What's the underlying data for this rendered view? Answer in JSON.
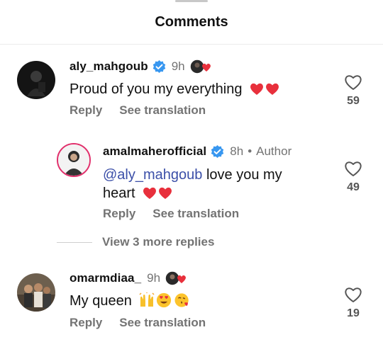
{
  "sheet": {
    "title": "Comments"
  },
  "comments": [
    {
      "username": "aly_mahgoub",
      "time": "9h",
      "text": "Proud of you my everything",
      "reply_label": "Reply",
      "translate_label": "See translation",
      "likes": "59"
    },
    {
      "username": "amalmaherofficial",
      "time": "8h",
      "separator": "•",
      "author_label": "Author",
      "mention": "@aly_mahgoub",
      "text": " love you my heart",
      "reply_label": "Reply",
      "translate_label": "See translation",
      "likes": "49"
    },
    {
      "username": "omarmdiaa_",
      "time": "9h",
      "text": "My queen",
      "reply_label": "Reply",
      "translate_label": "See translation",
      "likes": "19"
    }
  ],
  "view_more": {
    "label": "View 3 more replies"
  },
  "colors": {
    "verified": "#3897f0",
    "heart": "#e8303c",
    "secondary_text": "#737373",
    "mention": "#3b4fa8"
  },
  "icons": {
    "verified": "verified-badge-icon",
    "like": "heart-outline-icon",
    "emoji_heart": "red-heart-emoji",
    "emoji_hands": "raising-hands-emoji",
    "emoji_heart_eyes": "heart-eyes-emoji",
    "emoji_kiss": "face-blowing-kiss-emoji"
  }
}
